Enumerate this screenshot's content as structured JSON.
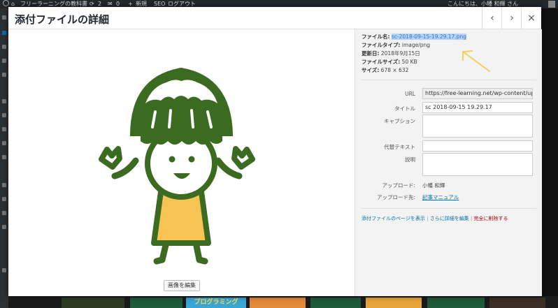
{
  "admin_bar": {
    "site_name": "フリーラーニングの教科書",
    "updates_count": "2",
    "comments_count": "0",
    "new_label": "新規",
    "seo_label": "SEO",
    "logout_label": "ログアウト",
    "greeting": "こんにちは、小幡 和輝 さん"
  },
  "modal": {
    "title": "添付ファイルの詳細",
    "prev_label": "‹",
    "next_label": "›",
    "close_label": "×",
    "edit_image_button": "画像を編集"
  },
  "meta": {
    "file_name_label": "ファイル名:",
    "file_name": "sc-2018-09-15-19.29.17.png",
    "file_type_label": "ファイルタイプ:",
    "file_type": "image/png",
    "updated_label": "更新日:",
    "updated": "2018年9月15日",
    "file_size_label": "ファイルサイズ:",
    "file_size": "50 KB",
    "dimensions_label": "サイズ:",
    "dimensions": "678 × 632"
  },
  "fields": {
    "url_label": "URL",
    "url_value": "https://free-learning.net/wp-content/uploa",
    "title_label": "タイトル",
    "title_value": "sc 2018-09-15 19.29.17",
    "caption_label": "キャプション",
    "caption_value": "",
    "alt_label": "代替テキスト",
    "alt_value": "",
    "description_label": "説明",
    "description_value": "",
    "uploaded_by_label": "アップロード:",
    "uploaded_by": "小幡 和輝",
    "uploaded_to_label": "アップロード先:",
    "uploaded_to": "記事マニュアル"
  },
  "actions": {
    "view_page": "添付ファイルのページを表示",
    "edit_more": "さらに詳細を編集",
    "delete": "完全に削除する",
    "separator": "|"
  },
  "background": {
    "programming_label": "プログラミング"
  },
  "colors": {
    "hat_green": "#3a6b20",
    "shirt_yellow": "#f6c452",
    "highlight": "#b3d4fc",
    "arrow": "#f2cf5a",
    "link": "#0073aa",
    "delete": "#a00"
  }
}
